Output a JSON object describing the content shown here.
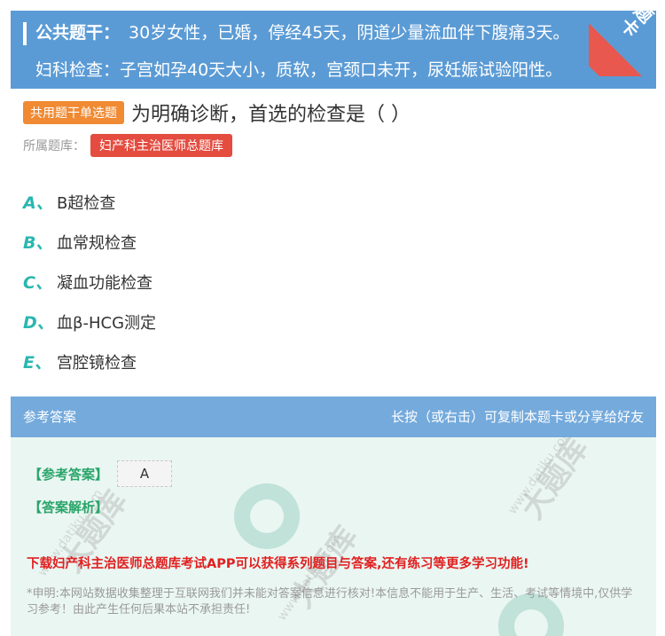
{
  "stem": {
    "label": "公共题干：",
    "line1": "30岁女性，已婚，停经45天，阴道少量流血伴下腹痛3天。",
    "line2": "妇科检查：子宫如孕40天大小，质软，宫颈口未开，尿妊娠试验阳性。"
  },
  "ribbon": {
    "text": "题卡"
  },
  "question": {
    "type_tag": "共用题干单选题",
    "text": "为明确诊断，首选的检查是（ ）"
  },
  "bank": {
    "label": "所属题库：",
    "name": "妇产科主治医师总题库"
  },
  "options": [
    {
      "letter": "A、",
      "text": "B超检查"
    },
    {
      "letter": "B、",
      "text": "血常规检查"
    },
    {
      "letter": "C、",
      "text": "凝血功能检查"
    },
    {
      "letter": "D、",
      "text": "血β-HCG测定"
    },
    {
      "letter": "E、",
      "text": "宫腔镜检查"
    }
  ],
  "answer_header": {
    "title": "参考答案",
    "hint": "长按（或右击）可复制本题卡或分享给好友"
  },
  "answer": {
    "ref_label": "【参考答案】",
    "ref_value": "A",
    "analysis_label": "【答案解析】",
    "promo": "下载妇产科主治医师总题库考试APP可以获得系列题目与答案,还有练习等更多学习功能!",
    "disclaimer": "*申明:本网站数据收集整理于互联网我们并未能对答案信息进行核对!本信息不能用于生产、生活、考试等情境中,仅供学习参考！由此产生任何后果本站不承担责任!"
  },
  "watermark": {
    "brand": "大题库",
    "url": "www.datiku.com"
  },
  "colors": {
    "stem_bg": "#5b9bd5",
    "ribbon": "#e8584f",
    "type_tag": "#f08a33",
    "bank_tag": "#e34c3f",
    "option_letter": "#2ab7b0",
    "answer_header": "#74aadc",
    "answer_bg": "#eaf6f2",
    "answer_label": "#2aa56a",
    "promo": "#e02020"
  }
}
